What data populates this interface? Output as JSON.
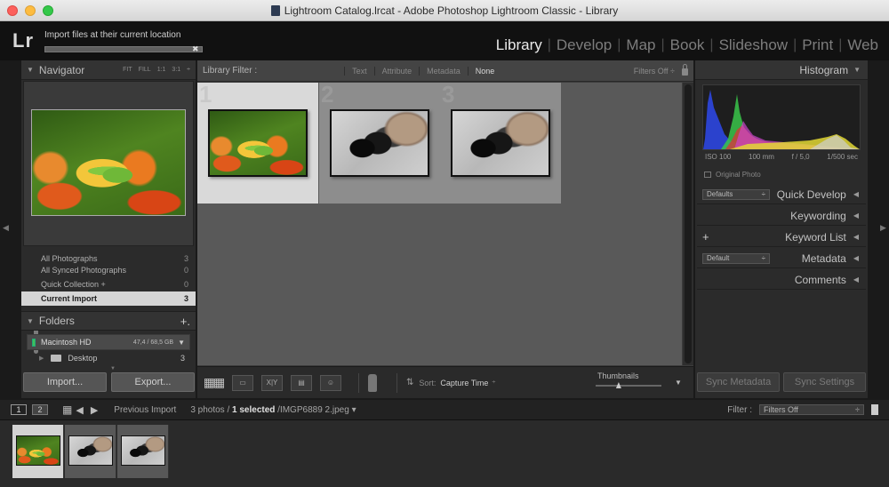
{
  "window": {
    "title": "Lightroom Catalog.lrcat - Adobe Photoshop Lightroom Classic - Library"
  },
  "header": {
    "logo": "Lr",
    "import_message": "Import files at their current location",
    "modules": [
      {
        "label": "Library",
        "active": true
      },
      {
        "label": "Develop"
      },
      {
        "label": "Map"
      },
      {
        "label": "Book"
      },
      {
        "label": "Slideshow"
      },
      {
        "label": "Print"
      },
      {
        "label": "Web"
      }
    ]
  },
  "navigator": {
    "title": "Navigator",
    "zoom": [
      "FIT",
      "FILL",
      "1:1",
      "3:1"
    ],
    "zoom_caret": "÷"
  },
  "catalog": {
    "items": [
      {
        "label": "All Photographs",
        "count": "3"
      },
      {
        "label": "All Synced Photographs",
        "count": "0"
      },
      {
        "label": "Quick Collection +",
        "count": "0"
      },
      {
        "label": "Current Import",
        "count": "3",
        "selected": true
      }
    ]
  },
  "folders": {
    "title": "Folders",
    "add": "+.",
    "volume": {
      "name": "Macintosh HD",
      "size": "47,4 / 68,5 GB"
    },
    "items": [
      {
        "label": "Desktop",
        "count": "3"
      }
    ]
  },
  "left_buttons": {
    "import": "Import...",
    "export": "Export..."
  },
  "library_filter": {
    "label": "Library Filter :",
    "options": [
      {
        "label": "Text"
      },
      {
        "label": "Attribute"
      },
      {
        "label": "Metadata"
      },
      {
        "label": "None",
        "active": true
      }
    ],
    "filters_off": "Filters Off ÷"
  },
  "grid": {
    "cells": [
      {
        "index": "1",
        "image": "grasshopper",
        "selected": true
      },
      {
        "index": "2",
        "image": "bee"
      },
      {
        "index": "3",
        "image": "bee"
      }
    ]
  },
  "toolbar": {
    "view_xy": "X|Y",
    "sort_label": "Sort:",
    "sort_value": "Capture Time",
    "sort_caret": "÷",
    "thumbnails_label": "Thumbnails",
    "thumbnails_level": 0.35
  },
  "right_panel": {
    "histogram_title": "Histogram",
    "histogram_info": [
      "ISO 100",
      "100 mm",
      "f / 5,0",
      "1/500 sec"
    ],
    "original_photo": "Original Photo",
    "quick_develop": {
      "preset": "Defaults",
      "label": "Quick Develop"
    },
    "keywording": "Keywording",
    "keyword_list": {
      "add": "+",
      "label": "Keyword List"
    },
    "metadata": {
      "preset": "Default",
      "label": "Metadata"
    },
    "comments": "Comments",
    "sync_metadata": "Sync Metadata",
    "sync_settings": "Sync Settings"
  },
  "filmstrip_bar": {
    "screen1": "1",
    "screen2": "2",
    "source": "Previous Import",
    "count_prefix": "3 photos /",
    "selected": "1 selected",
    "file": "/IMGP6889 2.jpeg",
    "caret": "▾",
    "filter_label": "Filter :",
    "filter_value": "Filters Off"
  },
  "filmstrip": {
    "items": [
      {
        "image": "grasshopper",
        "selected": true
      },
      {
        "image": "bee"
      },
      {
        "image": "bee"
      }
    ]
  },
  "colors": {
    "selected_cell": "#d9d9d9",
    "active_module": "#eaeaea",
    "panel_bg": "#2b2b2b"
  }
}
